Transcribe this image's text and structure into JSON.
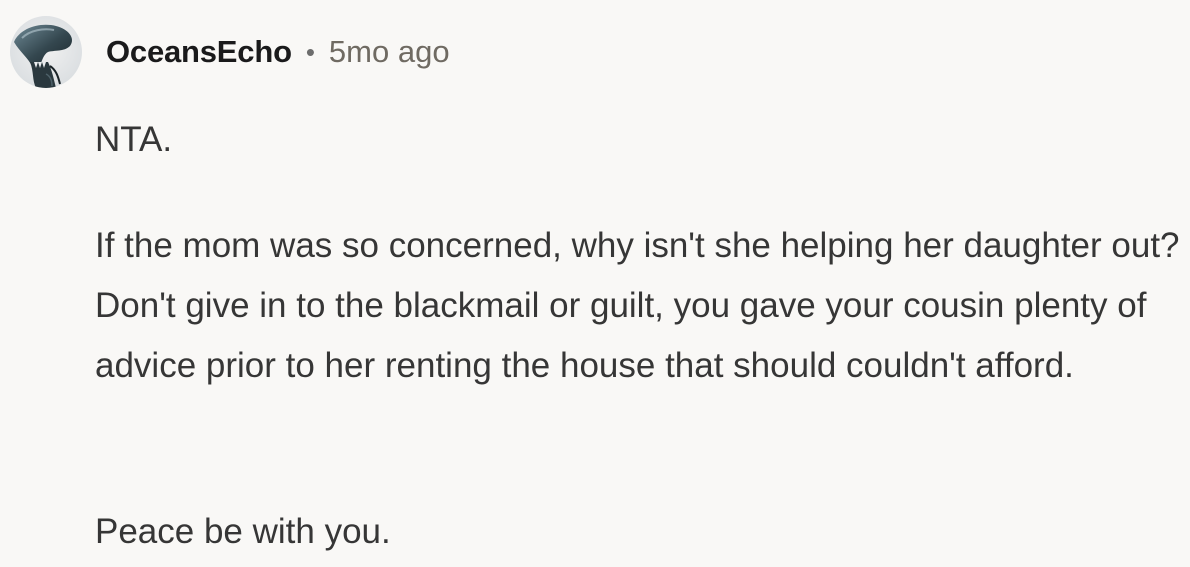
{
  "comment": {
    "author": "OceansEcho",
    "separator": "•",
    "timestamp": "5mo ago",
    "avatar_icon": "alien-xenomorph-avatar",
    "paragraphs": [
      "NTA.",
      "If the mom was so concerned, why isn't she helping her daughter out? Don't give in to the blackmail or guilt, you gave your cousin plenty of advice prior to her renting the house that should couldn't afford.",
      "Peace be with you."
    ]
  },
  "colors": {
    "background": "#f9f8f6",
    "username": "#1a1a1b",
    "timestamp": "#6f6a62",
    "body_text": "#363636"
  }
}
